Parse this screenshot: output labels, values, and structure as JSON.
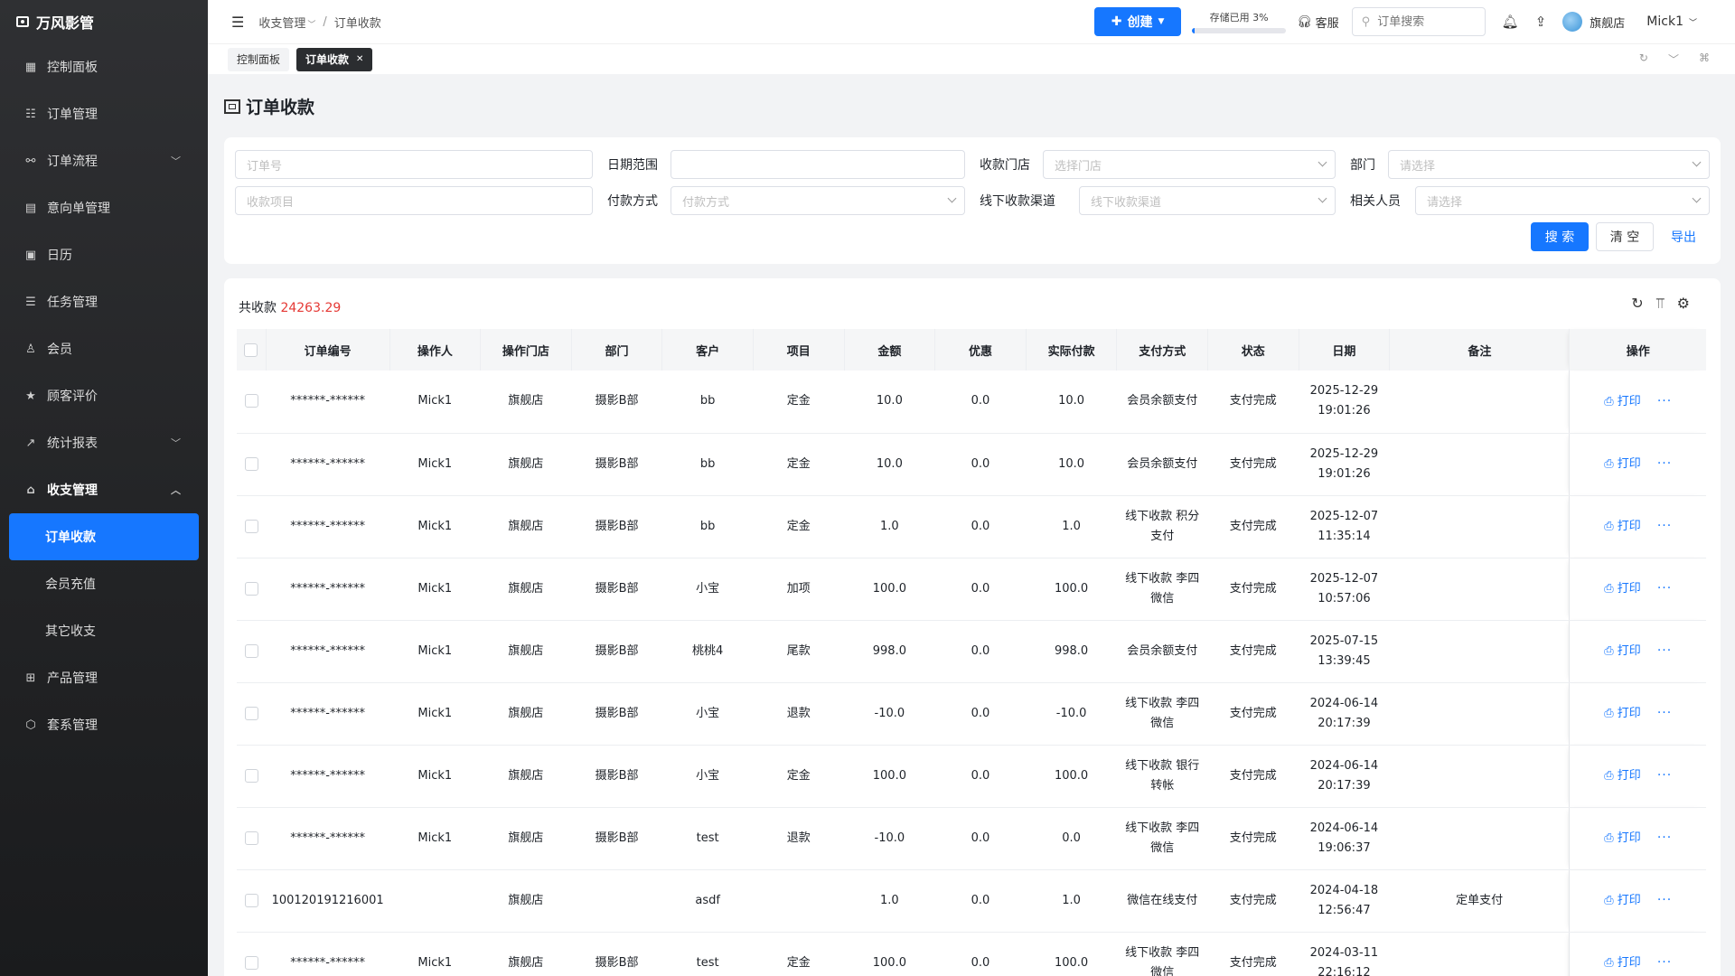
{
  "app": {
    "name": "万风影管"
  },
  "sidebar": {
    "items": [
      {
        "label": "控制面板",
        "icon": "dashboard-icon"
      },
      {
        "label": "订单管理",
        "icon": "list-icon"
      },
      {
        "label": "订单流程",
        "icon": "flow-icon",
        "has_arrow": true
      },
      {
        "label": "意向单管理",
        "icon": "clipboard-icon"
      },
      {
        "label": "日历",
        "icon": "calendar-icon"
      },
      {
        "label": "任务管理",
        "icon": "tasks-icon"
      },
      {
        "label": "会员",
        "icon": "user-icon"
      },
      {
        "label": "顾客评价",
        "icon": "star-icon"
      },
      {
        "label": "统计报表",
        "icon": "chart-icon",
        "has_arrow": true
      },
      {
        "label": "收支管理",
        "icon": "bank-icon",
        "open": true
      }
    ],
    "subitems": [
      {
        "label": "订单收款",
        "active": true
      },
      {
        "label": "会员充值"
      },
      {
        "label": "其它收支"
      }
    ],
    "items_after": [
      {
        "label": "产品管理",
        "icon": "grid-icon"
      },
      {
        "label": "套系管理",
        "icon": "box-icon"
      }
    ]
  },
  "header": {
    "breadcrumb": [
      "收支管理",
      "订单收款"
    ],
    "create_label": "创建",
    "storage_label": "存储已用 3%",
    "storage_used": 0.03,
    "service_label": "客服",
    "search_placeholder": "订单搜索",
    "store_name": "旗舰店",
    "user_name": "Mick1"
  },
  "tabs": [
    {
      "label": "控制面板",
      "active": false
    },
    {
      "label": "订单收款",
      "active": true
    }
  ],
  "page": {
    "title": "订单收款"
  },
  "filters": {
    "order_no_placeholder": "订单号",
    "date_range_label": "日期范围",
    "store_label": "收款门店",
    "store_placeholder": "选择门店",
    "dept_label": "部门",
    "dept_placeholder": "请选择",
    "item_placeholder": "收款项目",
    "pay_method_label": "付款方式",
    "pay_method_placeholder": "付款方式",
    "offline_channel_label": "线下收款渠道",
    "offline_channel_placeholder": "线下收款渠道",
    "staff_label": "相关人员",
    "staff_placeholder": "请选择",
    "search_btn": "搜 索",
    "clear_btn": "清 空",
    "export_btn": "导出"
  },
  "summary": {
    "label": "共收款",
    "value": "24263.29"
  },
  "table": {
    "columns": [
      "订单编号",
      "操作人",
      "操作门店",
      "部门",
      "客户",
      "项目",
      "金额",
      "优惠",
      "实际付款",
      "支付方式",
      "状态",
      "日期",
      "备注",
      "操作"
    ],
    "print_label": "打印",
    "more_label": "···",
    "rows": [
      {
        "order_no": "******-******",
        "operator": "Mick1",
        "store": "旗舰店",
        "dept": "摄影B部",
        "customer": "bb",
        "item": "定金",
        "amount": "10.0",
        "discount": "0.0",
        "paid": "10.0",
        "method": "会员余额支付",
        "status": "支付完成",
        "date": "2025-12-29",
        "time": "19:01:26",
        "note": ""
      },
      {
        "order_no": "******-******",
        "operator": "Mick1",
        "store": "旗舰店",
        "dept": "摄影B部",
        "customer": "bb",
        "item": "定金",
        "amount": "10.0",
        "discount": "0.0",
        "paid": "10.0",
        "method": "会员余额支付",
        "status": "支付完成",
        "date": "2025-12-29",
        "time": "19:01:26",
        "note": ""
      },
      {
        "order_no": "******-******",
        "operator": "Mick1",
        "store": "旗舰店",
        "dept": "摄影B部",
        "customer": "bb",
        "item": "定金",
        "amount": "1.0",
        "discount": "0.0",
        "paid": "1.0",
        "method": "线下收款 积分支付",
        "status": "支付完成",
        "date": "2025-12-07",
        "time": "11:35:14",
        "note": ""
      },
      {
        "order_no": "******-******",
        "operator": "Mick1",
        "store": "旗舰店",
        "dept": "摄影B部",
        "customer": "小宝",
        "item": "加项",
        "amount": "100.0",
        "discount": "0.0",
        "paid": "100.0",
        "method": "线下收款 李四微信",
        "status": "支付完成",
        "date": "2025-12-07",
        "time": "10:57:06",
        "note": ""
      },
      {
        "order_no": "******-******",
        "operator": "Mick1",
        "store": "旗舰店",
        "dept": "摄影B部",
        "customer": "桃桃4",
        "item": "尾款",
        "amount": "998.0",
        "discount": "0.0",
        "paid": "998.0",
        "method": "会员余额支付",
        "status": "支付完成",
        "date": "2025-07-15",
        "time": "13:39:45",
        "note": ""
      },
      {
        "order_no": "******-******",
        "operator": "Mick1",
        "store": "旗舰店",
        "dept": "摄影B部",
        "customer": "小宝",
        "item": "退款",
        "amount": "-10.0",
        "discount": "0.0",
        "paid": "-10.0",
        "method": "线下收款 李四微信",
        "status": "支付完成",
        "date": "2024-06-14",
        "time": "20:17:39",
        "note": ""
      },
      {
        "order_no": "******-******",
        "operator": "Mick1",
        "store": "旗舰店",
        "dept": "摄影B部",
        "customer": "小宝",
        "item": "定金",
        "amount": "100.0",
        "discount": "0.0",
        "paid": "100.0",
        "method": "线下收款 银行转帐",
        "status": "支付完成",
        "date": "2024-06-14",
        "time": "20:17:39",
        "note": ""
      },
      {
        "order_no": "******-******",
        "operator": "Mick1",
        "store": "旗舰店",
        "dept": "摄影B部",
        "customer": "test",
        "item": "退款",
        "amount": "-10.0",
        "discount": "0.0",
        "paid": "0.0",
        "method": "线下收款 李四微信",
        "status": "支付完成",
        "date": "2024-06-14",
        "time": "19:06:37",
        "note": ""
      },
      {
        "order_no": "100120191216001",
        "operator": "",
        "store": "旗舰店",
        "dept": "",
        "customer": "asdf",
        "item": "",
        "amount": "1.0",
        "discount": "0.0",
        "paid": "1.0",
        "method": "微信在线支付",
        "status": "支付完成",
        "date": "2024-04-18",
        "time": "12:56:47",
        "note": "定单支付"
      },
      {
        "order_no": "******-******",
        "operator": "Mick1",
        "store": "旗舰店",
        "dept": "摄影B部",
        "customer": "test",
        "item": "定金",
        "amount": "100.0",
        "discount": "0.0",
        "paid": "100.0",
        "method": "线下收款 李四微信",
        "status": "支付完成",
        "date": "2024-03-11",
        "time": "22:16:12",
        "note": ""
      }
    ]
  },
  "colors": {
    "primary": "#1677ff",
    "sidebar_bg": "#2f3033",
    "total_value": "#e53935"
  }
}
